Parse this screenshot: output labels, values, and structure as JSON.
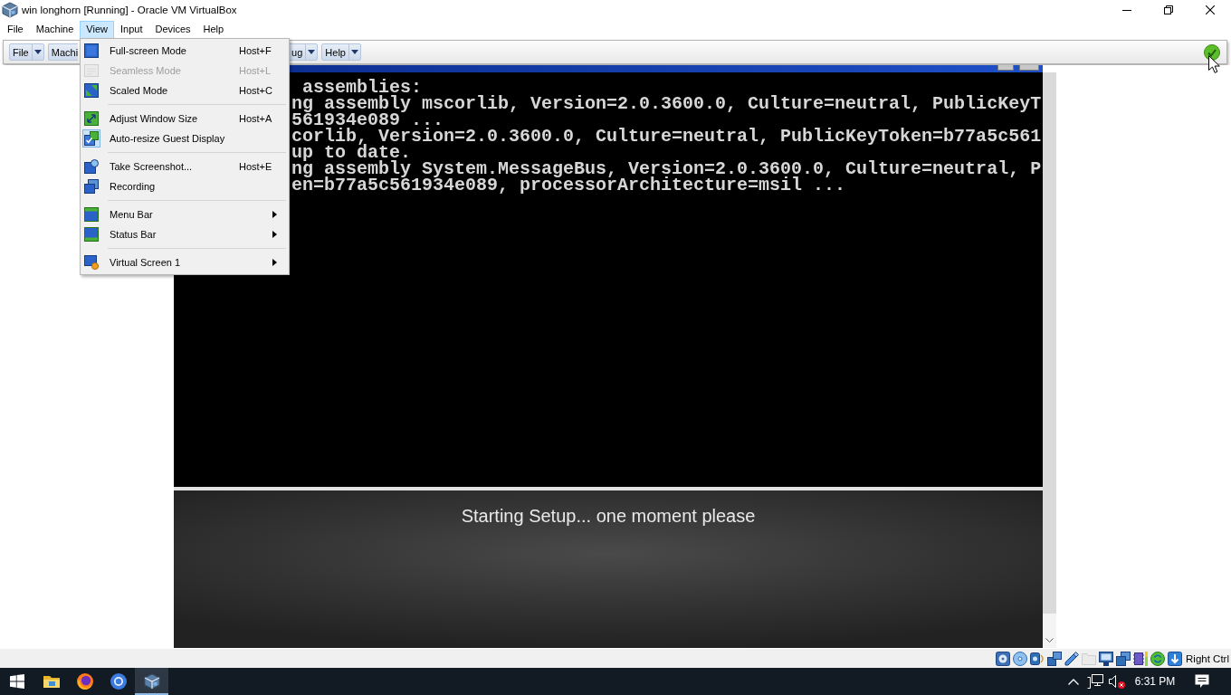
{
  "window": {
    "title": "win longhorn [Running] - Oracle VM VirtualBox"
  },
  "menu_bar": [
    {
      "label": "File",
      "selected": false
    },
    {
      "label": "Machine",
      "selected": false
    },
    {
      "label": "View",
      "selected": true
    },
    {
      "label": "Input",
      "selected": false
    },
    {
      "label": "Devices",
      "selected": false
    },
    {
      "label": "Help",
      "selected": false
    }
  ],
  "mini_toolbar": {
    "buttons": [
      {
        "label": "File",
        "dropdown": true
      },
      {
        "label": "Machi",
        "dropdown": false
      },
      {
        "label": "ug",
        "dropdown": true
      },
      {
        "label": "Help",
        "dropdown": true
      }
    ]
  },
  "view_menu": {
    "sections": [
      {
        "items": [
          {
            "kind": "fullscreen",
            "label": "Full-screen Mode",
            "shortcut": "Host+F",
            "disabled": false,
            "checked": false,
            "submenu": false
          },
          {
            "kind": "seamless",
            "label": "Seamless Mode",
            "shortcut": "Host+L",
            "disabled": true,
            "checked": false,
            "submenu": false
          },
          {
            "kind": "scaled",
            "label": "Scaled Mode",
            "shortcut": "Host+C",
            "disabled": false,
            "checked": false,
            "submenu": false
          }
        ]
      },
      {
        "items": [
          {
            "kind": "adjust",
            "label": "Adjust Window Size",
            "shortcut": "Host+A",
            "disabled": false,
            "checked": false,
            "submenu": false
          },
          {
            "kind": "autoresize",
            "label": "Auto-resize Guest Display",
            "disabled": false,
            "checked": true,
            "submenu": false
          }
        ]
      },
      {
        "items": [
          {
            "kind": "screenshot",
            "label": "Take Screenshot...",
            "shortcut": "Host+E",
            "disabled": false,
            "checked": false,
            "submenu": false
          },
          {
            "kind": "recording",
            "label": "Recording",
            "disabled": false,
            "checked": false,
            "submenu": false
          }
        ]
      },
      {
        "items": [
          {
            "kind": "menubar",
            "label": "Menu Bar",
            "disabled": false,
            "checked": false,
            "submenu": true
          },
          {
            "kind": "statusbar",
            "label": "Status Bar",
            "disabled": false,
            "checked": false,
            "submenu": true
          }
        ]
      },
      {
        "items": [
          {
            "kind": "screen",
            "label": "Virtual Screen 1",
            "disabled": false,
            "checked": false,
            "submenu": true
          }
        ]
      }
    ]
  },
  "guest_screen": {
    "console_lines": [
      " assemblies:",
      "ng assembly mscorlib, Version=2.0.3600.0, Culture=neutral, PublicKeyT",
      "561934e089 ...",
      "corlib, Version=2.0.3600.0, Culture=neutral, PublicKeyToken=b77a5c561",
      "up to date.",
      "ng assembly System.MessageBus, Version=2.0.3600.0, Culture=neutral, P",
      "en=b77a5c561934e089, processorArchitecture=msil ..."
    ],
    "setup_message": "Starting Setup... one moment please"
  },
  "status_bar": {
    "indicators": [
      {
        "kind": "disk",
        "disabled": false
      },
      {
        "kind": "optical",
        "disabled": false
      },
      {
        "kind": "audio",
        "disabled": false
      },
      {
        "kind": "network",
        "disabled": false
      },
      {
        "kind": "usb",
        "disabled": false
      },
      {
        "kind": "shared",
        "disabled": true
      },
      {
        "kind": "display",
        "disabled": false
      },
      {
        "kind": "capture",
        "disabled": false
      },
      {
        "kind": "cpu",
        "disabled": false
      },
      {
        "kind": "mouse",
        "disabled": false
      },
      {
        "kind": "hostkey",
        "disabled": false
      }
    ],
    "host_key": "Right Ctrl"
  },
  "taskbar": {
    "apps": [
      {
        "kind": "files",
        "selected": false
      },
      {
        "kind": "firefox",
        "selected": false
      },
      {
        "kind": "chrome",
        "selected": false
      },
      {
        "kind": "virtualbox",
        "selected": true
      }
    ],
    "tray": [
      {
        "kind": "overflow"
      },
      {
        "kind": "network"
      },
      {
        "kind": "muted"
      }
    ],
    "clock": "6:31 PM"
  }
}
